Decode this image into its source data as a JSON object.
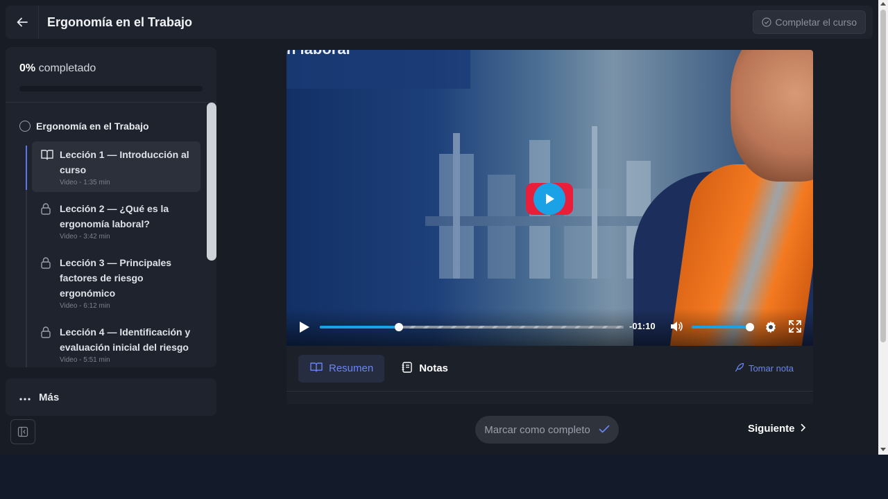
{
  "header": {
    "title": "Ergonomía en el Trabajo",
    "complete_course_label": "Completar el curso"
  },
  "sidebar": {
    "progress_value": "0%",
    "progress_suffix": " completado",
    "progress_fraction": 0,
    "module_title": "Ergonomía en el Trabajo",
    "lessons": [
      {
        "title": "Lección 1 — Introducción al curso",
        "meta": "Video - 1:35 min",
        "icon": "book-open-icon",
        "state": "active"
      },
      {
        "title": "Lección 2 — ¿Qué es la ergonomía laboral?",
        "meta": "Video - 3:42 min",
        "icon": "lock-icon",
        "state": "locked"
      },
      {
        "title": "Lección 3 — Principales factores de riesgo ergonómico",
        "meta": "Video - 6:12 min",
        "icon": "lock-icon",
        "state": "locked"
      },
      {
        "title": "Lección 4 — Identificación y evaluación inicial del riesgo",
        "meta": "Video - 5:51 min",
        "icon": "lock-icon",
        "state": "locked"
      }
    ],
    "more_label": "Más"
  },
  "video": {
    "caption": "n laboral",
    "time_remaining": "-01:10",
    "played_fraction": 0.26,
    "volume_fraction": 1.0
  },
  "tabs": {
    "summary_label": "Resumen",
    "notes_label": "Notas",
    "take_note_label": "Tomar nota"
  },
  "nav": {
    "mark_complete_label": "Marcar como completo",
    "next_label": "Siguiente"
  },
  "colors": {
    "accent": "#5b74f0",
    "player_accent": "#1ba1e6",
    "play_button_bg": "#e81e3b"
  }
}
